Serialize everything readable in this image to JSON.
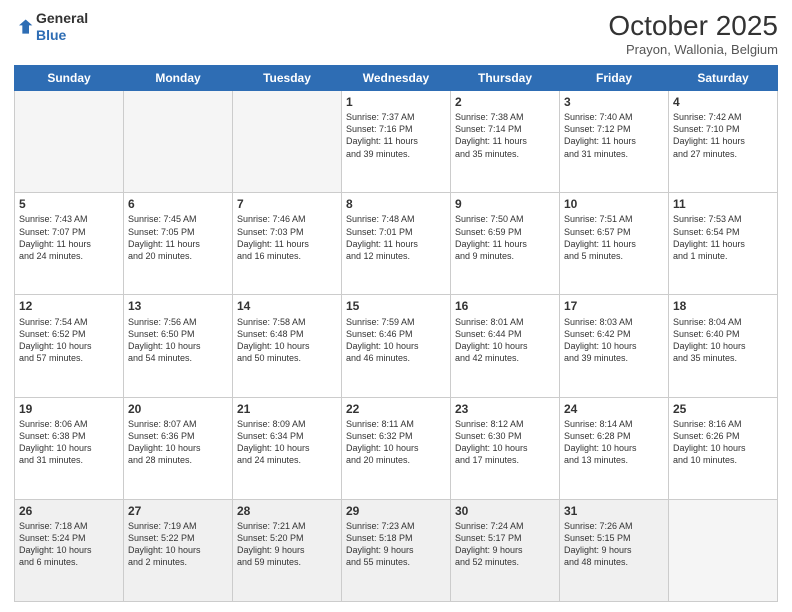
{
  "header": {
    "logo_line1": "General",
    "logo_line2": "Blue",
    "month": "October 2025",
    "location": "Prayon, Wallonia, Belgium"
  },
  "weekdays": [
    "Sunday",
    "Monday",
    "Tuesday",
    "Wednesday",
    "Thursday",
    "Friday",
    "Saturday"
  ],
  "weeks": [
    [
      {
        "day": "",
        "info": ""
      },
      {
        "day": "",
        "info": ""
      },
      {
        "day": "",
        "info": ""
      },
      {
        "day": "1",
        "info": "Sunrise: 7:37 AM\nSunset: 7:16 PM\nDaylight: 11 hours\nand 39 minutes."
      },
      {
        "day": "2",
        "info": "Sunrise: 7:38 AM\nSunset: 7:14 PM\nDaylight: 11 hours\nand 35 minutes."
      },
      {
        "day": "3",
        "info": "Sunrise: 7:40 AM\nSunset: 7:12 PM\nDaylight: 11 hours\nand 31 minutes."
      },
      {
        "day": "4",
        "info": "Sunrise: 7:42 AM\nSunset: 7:10 PM\nDaylight: 11 hours\nand 27 minutes."
      }
    ],
    [
      {
        "day": "5",
        "info": "Sunrise: 7:43 AM\nSunset: 7:07 PM\nDaylight: 11 hours\nand 24 minutes."
      },
      {
        "day": "6",
        "info": "Sunrise: 7:45 AM\nSunset: 7:05 PM\nDaylight: 11 hours\nand 20 minutes."
      },
      {
        "day": "7",
        "info": "Sunrise: 7:46 AM\nSunset: 7:03 PM\nDaylight: 11 hours\nand 16 minutes."
      },
      {
        "day": "8",
        "info": "Sunrise: 7:48 AM\nSunset: 7:01 PM\nDaylight: 11 hours\nand 12 minutes."
      },
      {
        "day": "9",
        "info": "Sunrise: 7:50 AM\nSunset: 6:59 PM\nDaylight: 11 hours\nand 9 minutes."
      },
      {
        "day": "10",
        "info": "Sunrise: 7:51 AM\nSunset: 6:57 PM\nDaylight: 11 hours\nand 5 minutes."
      },
      {
        "day": "11",
        "info": "Sunrise: 7:53 AM\nSunset: 6:54 PM\nDaylight: 11 hours\nand 1 minute."
      }
    ],
    [
      {
        "day": "12",
        "info": "Sunrise: 7:54 AM\nSunset: 6:52 PM\nDaylight: 10 hours\nand 57 minutes."
      },
      {
        "day": "13",
        "info": "Sunrise: 7:56 AM\nSunset: 6:50 PM\nDaylight: 10 hours\nand 54 minutes."
      },
      {
        "day": "14",
        "info": "Sunrise: 7:58 AM\nSunset: 6:48 PM\nDaylight: 10 hours\nand 50 minutes."
      },
      {
        "day": "15",
        "info": "Sunrise: 7:59 AM\nSunset: 6:46 PM\nDaylight: 10 hours\nand 46 minutes."
      },
      {
        "day": "16",
        "info": "Sunrise: 8:01 AM\nSunset: 6:44 PM\nDaylight: 10 hours\nand 42 minutes."
      },
      {
        "day": "17",
        "info": "Sunrise: 8:03 AM\nSunset: 6:42 PM\nDaylight: 10 hours\nand 39 minutes."
      },
      {
        "day": "18",
        "info": "Sunrise: 8:04 AM\nSunset: 6:40 PM\nDaylight: 10 hours\nand 35 minutes."
      }
    ],
    [
      {
        "day": "19",
        "info": "Sunrise: 8:06 AM\nSunset: 6:38 PM\nDaylight: 10 hours\nand 31 minutes."
      },
      {
        "day": "20",
        "info": "Sunrise: 8:07 AM\nSunset: 6:36 PM\nDaylight: 10 hours\nand 28 minutes."
      },
      {
        "day": "21",
        "info": "Sunrise: 8:09 AM\nSunset: 6:34 PM\nDaylight: 10 hours\nand 24 minutes."
      },
      {
        "day": "22",
        "info": "Sunrise: 8:11 AM\nSunset: 6:32 PM\nDaylight: 10 hours\nand 20 minutes."
      },
      {
        "day": "23",
        "info": "Sunrise: 8:12 AM\nSunset: 6:30 PM\nDaylight: 10 hours\nand 17 minutes."
      },
      {
        "day": "24",
        "info": "Sunrise: 8:14 AM\nSunset: 6:28 PM\nDaylight: 10 hours\nand 13 minutes."
      },
      {
        "day": "25",
        "info": "Sunrise: 8:16 AM\nSunset: 6:26 PM\nDaylight: 10 hours\nand 10 minutes."
      }
    ],
    [
      {
        "day": "26",
        "info": "Sunrise: 7:18 AM\nSunset: 5:24 PM\nDaylight: 10 hours\nand 6 minutes."
      },
      {
        "day": "27",
        "info": "Sunrise: 7:19 AM\nSunset: 5:22 PM\nDaylight: 10 hours\nand 2 minutes."
      },
      {
        "day": "28",
        "info": "Sunrise: 7:21 AM\nSunset: 5:20 PM\nDaylight: 9 hours\nand 59 minutes."
      },
      {
        "day": "29",
        "info": "Sunrise: 7:23 AM\nSunset: 5:18 PM\nDaylight: 9 hours\nand 55 minutes."
      },
      {
        "day": "30",
        "info": "Sunrise: 7:24 AM\nSunset: 5:17 PM\nDaylight: 9 hours\nand 52 minutes."
      },
      {
        "day": "31",
        "info": "Sunrise: 7:26 AM\nSunset: 5:15 PM\nDaylight: 9 hours\nand 48 minutes."
      },
      {
        "day": "",
        "info": ""
      }
    ]
  ]
}
